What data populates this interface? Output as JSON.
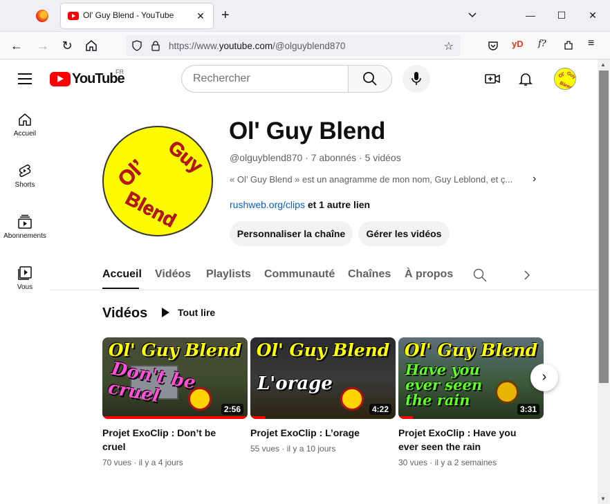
{
  "browser": {
    "tab_title": "Ol' Guy Blend - YouTube",
    "url_prefix": "https://www.",
    "url_domain": "youtube.com",
    "url_path": "/@olguyblend870",
    "window_controls": [
      "—",
      "☐",
      "✕"
    ]
  },
  "header": {
    "logo_text": "YouTube",
    "country_code": "FR",
    "search_placeholder": "Rechercher"
  },
  "guide": {
    "items": [
      {
        "label": "Accueil",
        "icon": "home-icon"
      },
      {
        "label": "Shorts",
        "icon": "shorts-icon"
      },
      {
        "label": "Abonnements",
        "icon": "subscriptions-icon"
      },
      {
        "label": "Vous",
        "icon": "library-icon"
      }
    ]
  },
  "channel": {
    "name": "Ol' Guy Blend",
    "handle_meta": "@olguyblend870 · 7 abonnés · 5 vidéos",
    "description": "« Ol’ Guy Blend » est un anagramme de mon nom, Guy Leblond, et ç...",
    "link": "rushweb.org/clips",
    "link_more": "et 1 autre lien",
    "customize_label": "Personnaliser la chaîne",
    "manage_label": "Gérer les vidéos",
    "avatar_text": "Ol' Guy Blend"
  },
  "tabs": [
    "Accueil",
    "Vidéos",
    "Playlists",
    "Communauté",
    "Chaînes",
    "À propos"
  ],
  "section": {
    "title": "Vidéos",
    "play_all": "Tout lire"
  },
  "videos": [
    {
      "thumb_title": "Ol' Guy Blend",
      "thumb_text": "Don't be cruel",
      "title": "Projet ExoClip : Don’t be cruel",
      "meta": "70 vues · il y a 4 jours",
      "duration": "2:56",
      "progress": 1.0
    },
    {
      "thumb_title": "Ol' Guy Blend",
      "thumb_text": "L'orage",
      "title": "Projet ExoClip : L’orage",
      "meta": "55 vues · il y a 10 jours",
      "duration": "4:22",
      "progress": 0.1
    },
    {
      "thumb_title": "Ol' Guy Blend",
      "thumb_text": "Have you ever seen the rain",
      "title": "Projet ExoClip : Have you ever seen the rain",
      "meta": "30 vues · il y a 2 semaines",
      "duration": "3:31",
      "progress": 0.1
    }
  ],
  "colors": {
    "yt_red": "#ff0000",
    "link_blue": "#065fd4",
    "avatar_yellow": "#fffa00"
  }
}
